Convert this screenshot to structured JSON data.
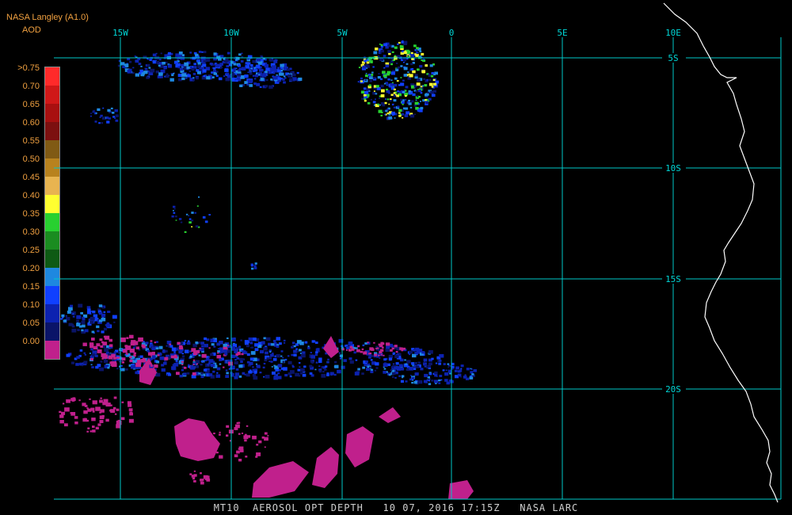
{
  "header": {
    "title": "NASA Langley (A1.0)",
    "variable": "AOD"
  },
  "legend": {
    "items": [
      {
        "label": ">0.75",
        "color": "#ff2a2a"
      },
      {
        "label": "0.70",
        "color": "#d01818"
      },
      {
        "label": "0.65",
        "color": "#a81010"
      },
      {
        "label": "0.60",
        "color": "#7c1010"
      },
      {
        "label": "0.55",
        "color": "#805a14"
      },
      {
        "label": "0.50",
        "color": "#b8821e"
      },
      {
        "label": "0.45",
        "color": "#e8b450"
      },
      {
        "label": "0.40",
        "color": "#ffff30"
      },
      {
        "label": "0.35",
        "color": "#28d030"
      },
      {
        "label": "0.30",
        "color": "#1a8c20"
      },
      {
        "label": "0.25",
        "color": "#0e5a14"
      },
      {
        "label": "0.20",
        "color": "#1e88e0"
      },
      {
        "label": "0.15",
        "color": "#1040ff"
      },
      {
        "label": "0.10",
        "color": "#0c22b0"
      },
      {
        "label": "0.05",
        "color": "#0a1468"
      },
      {
        "label": "0.00",
        "color": "#c0208c"
      }
    ]
  },
  "grid": {
    "lon_labels": [
      "15W",
      "10W",
      "5W",
      "0",
      "5E",
      "10E"
    ],
    "lat_labels": [
      "5S",
      "10S",
      "15S",
      "20S"
    ],
    "line_color": "#00c8c8"
  },
  "footer": {
    "text": "MT10  AEROSOL OPT DEPTH   10 07, 2016 17:15Z   NASA LARC"
  },
  "colors": {
    "coast": "#ffffff",
    "low_aod": "#c0208c",
    "mid_aod": "#0c22b0",
    "background": "#000000"
  }
}
